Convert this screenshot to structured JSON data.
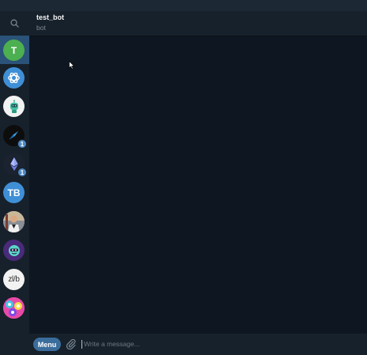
{
  "chat": {
    "title": "test_bot",
    "status": "bot"
  },
  "sidebar": {
    "items": [
      {
        "type": "letter",
        "letter": "T",
        "color": "#4caf50",
        "active": true
      },
      {
        "type": "icon",
        "icon": "openai-logo-icon",
        "color": "#3f8fd6"
      },
      {
        "type": "icon",
        "icon": "robot-avatar-icon",
        "color": "#f2f2f2"
      },
      {
        "type": "icon",
        "icon": "swirl-logo-icon",
        "color": "#0d0d0d",
        "badge": "1"
      },
      {
        "type": "icon",
        "icon": "ethereum-logo-icon",
        "color": "#1b2230",
        "badge": "1"
      },
      {
        "type": "letter",
        "letter": "TB",
        "color": "#3f8fd6"
      },
      {
        "type": "icon",
        "icon": "person-photo-icon",
        "color": "#6a7480"
      },
      {
        "type": "icon",
        "icon": "mascot-avatar-icon",
        "color": "#4a2a7a"
      },
      {
        "type": "icon",
        "icon": "zlib-logo-icon",
        "color": "#f2f2f2",
        "text": "zl/b"
      },
      {
        "type": "icon",
        "icon": "colorful-pattern-icon",
        "color": "#e84aa8"
      }
    ]
  },
  "composer": {
    "menu_label": "Menu",
    "placeholder": "Write a message..."
  },
  "colors": {
    "background": "#0e1621",
    "panel": "#17212b",
    "accent": "#2b5278",
    "badge": "#4f89c4"
  }
}
